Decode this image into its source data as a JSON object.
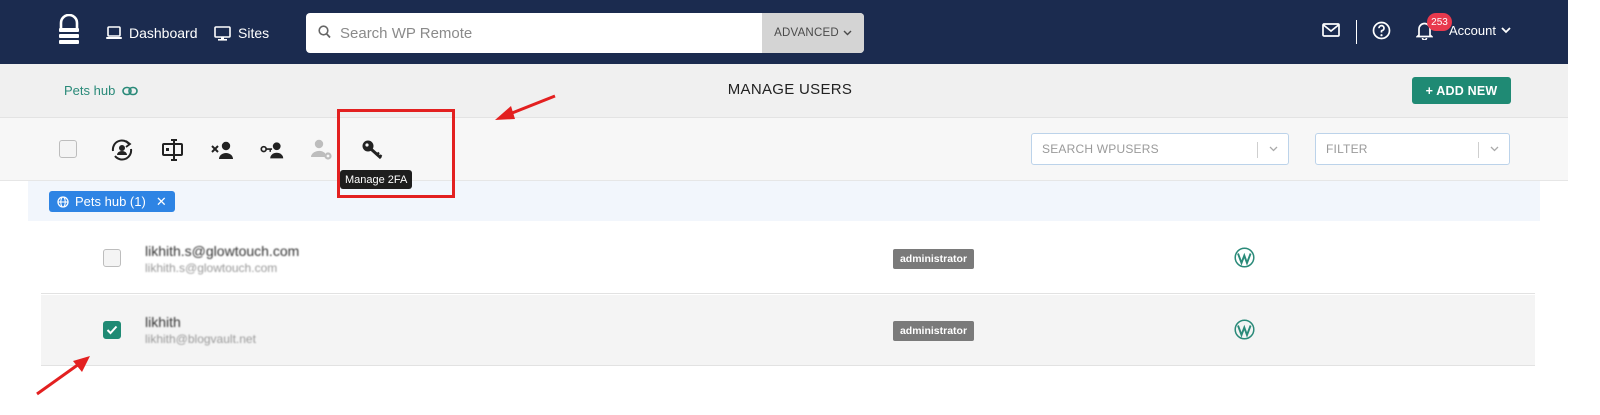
{
  "nav": {
    "dashboard": "Dashboard",
    "sites": "Sites",
    "search_placeholder": "Search WP Remote",
    "advanced": "ADVANCED",
    "notification_count": "253",
    "account": "Account"
  },
  "header": {
    "site_name": "Pets hub",
    "title": "MANAGE USERS",
    "add_new": "+ ADD NEW"
  },
  "toolbar": {
    "tools": [
      "sync-users-icon",
      "change-role-icon",
      "delete-user-icon",
      "reset-password-icon",
      "user-settings-icon",
      "key-icon"
    ],
    "tooltip": "Manage 2FA",
    "search_users_placeholder": "SEARCH WPUSERS",
    "filter_placeholder": "FILTER"
  },
  "filter_chip": {
    "label": "Pets hub (1)"
  },
  "users": [
    {
      "name": "likhith.s@glowtouch.com",
      "email": "likhith.s@glowtouch.com",
      "role": "administrator",
      "checked": false
    },
    {
      "name": "likhith",
      "email": "likhith@blogvault.net",
      "role": "administrator",
      "checked": true
    }
  ],
  "colors": {
    "nav_bg": "#1b2b4f",
    "accent": "#1f8a74",
    "chip": "#2e84e4",
    "badge": "#e8394d",
    "annotation": "#e32020"
  }
}
